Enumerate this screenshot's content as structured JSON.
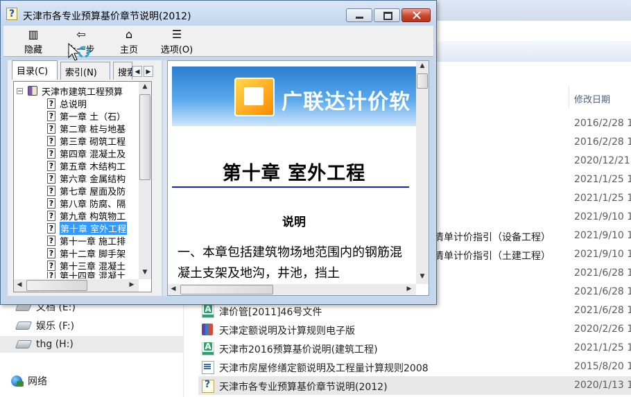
{
  "explorer": {
    "column_date_label": "修改日期",
    "nav": [
      {
        "label": "文档 (E:)",
        "icon": "drive-icon"
      },
      {
        "label": "娱乐 (F:)",
        "icon": "drive-icon"
      },
      {
        "label": "thg (H:)",
        "icon": "drive-icon"
      },
      {
        "label": "网络",
        "icon": "network-icon"
      }
    ],
    "partial_dates": [
      "2016/2/28 1",
      "2016/2/28 1",
      "2020/12/21",
      "2021/1/25 1",
      "2021/1/25 1",
      "2021/9/10 1"
    ],
    "files": [
      {
        "name": "清单计价指引（设备工程）",
        "date": "2021/9/10 1",
        "icon": "none"
      },
      {
        "name": "清单计价指引（土建工程）",
        "date": "2021/9/10 1",
        "icon": "none"
      },
      {
        "name": "",
        "date": "2021/6/28 1",
        "icon": "none"
      },
      {
        "name": "",
        "date": "2021/6/28 1",
        "icon": "none"
      },
      {
        "name": "津价管[2011]46号文件",
        "date": "2021/6/28 1",
        "icon": "pdf-icon"
      },
      {
        "name": "天津定额说明及计算规则电子版",
        "date": "2020/2/26 1",
        "icon": "rar-icon"
      },
      {
        "name": "天津市2016预算基价说明(建筑工程)",
        "date": "2021/1/25 1",
        "icon": "pdf-icon"
      },
      {
        "name": "天津市房屋修缮定额说明及工程量计算规则2008",
        "date": "2015/8/20 1",
        "icon": "doc-icon"
      },
      {
        "name": "天津市各专业预算基价章节说明(2012)",
        "date": "2020/1/13 1",
        "icon": "chm-icon"
      }
    ]
  },
  "help": {
    "title": "天津市各专业预算基价章节说明(2012)",
    "toolbar": [
      {
        "label": "隐藏",
        "icon": "hide-pane-icon",
        "glyph": "▥"
      },
      {
        "label": "上一步",
        "icon": "back-arrow-icon",
        "glyph": "⇦"
      },
      {
        "label": "主页",
        "icon": "home-icon",
        "glyph": "⌂"
      },
      {
        "label": "选项(O)",
        "icon": "options-icon",
        "glyph": "☰"
      }
    ],
    "tabs": [
      {
        "label": "目录(C)"
      },
      {
        "label": "索引(N)"
      },
      {
        "label": "搜索"
      }
    ],
    "tree": {
      "root": "天津市建筑工程预算",
      "items": [
        "总说明",
        "第一章  土（石）",
        "第二章  桩与地基",
        "第三章  砌筑工程",
        "第四章  混凝土及",
        "第五章  木结构工",
        "第六章  金属结构",
        "第七章  屋面及防",
        "第八章  防腐、隔",
        "第九章  构筑物工",
        "第十章  室外工程",
        "第十一章  施工排",
        "第十二章  脚手架",
        "第十三章  混凝土",
        "第十四章  混凝土"
      ],
      "selected_index": 10
    },
    "content": {
      "banner_text": "广联达计价软",
      "chapter_title": "第十章  室外工程",
      "section_heading": "说明",
      "paragraph": "一、本章包括建筑物场地范围内的钢筋混凝土支架及地沟，井池，挡土"
    }
  }
}
